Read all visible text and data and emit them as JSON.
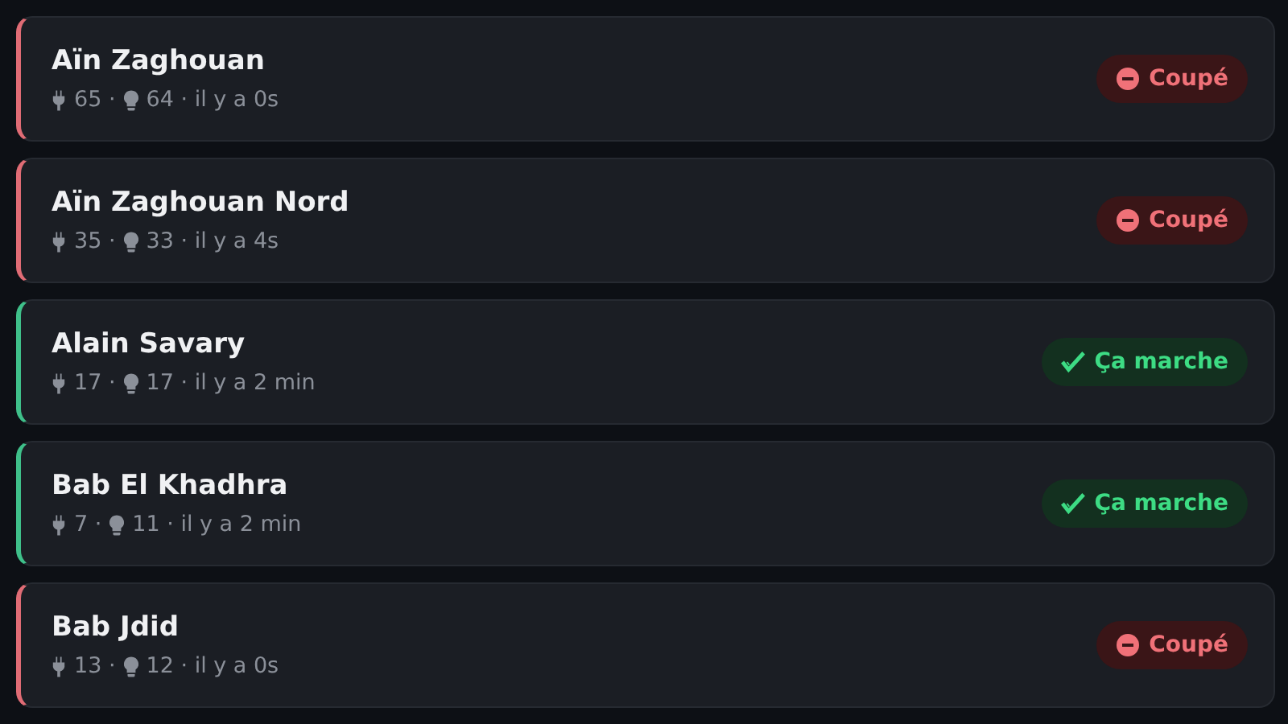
{
  "stations": [
    {
      "name": "Aïn Zaghouan",
      "plugs": "65 ·",
      "bulbs": "64 · il y a 0s",
      "status": {
        "kind": "off",
        "label": "Coupé"
      }
    },
    {
      "name": "Aïn Zaghouan Nord",
      "plugs": "35 ·",
      "bulbs": "33 · il y a 4s",
      "status": {
        "kind": "off",
        "label": "Coupé"
      }
    },
    {
      "name": "Alain Savary",
      "plugs": "17 ·",
      "bulbs": "17 · il y a 2 min",
      "status": {
        "kind": "on",
        "label": "Ça marche"
      }
    },
    {
      "name": "Bab El Khadhra",
      "plugs": "7 ·",
      "bulbs": "11 · il y a 2 min",
      "status": {
        "kind": "on",
        "label": "Ça marche"
      }
    },
    {
      "name": "Bab Jdid",
      "plugs": "13 ·",
      "bulbs": "12 · il y a 0s",
      "status": {
        "kind": "off",
        "label": "Coupé"
      }
    }
  ]
}
